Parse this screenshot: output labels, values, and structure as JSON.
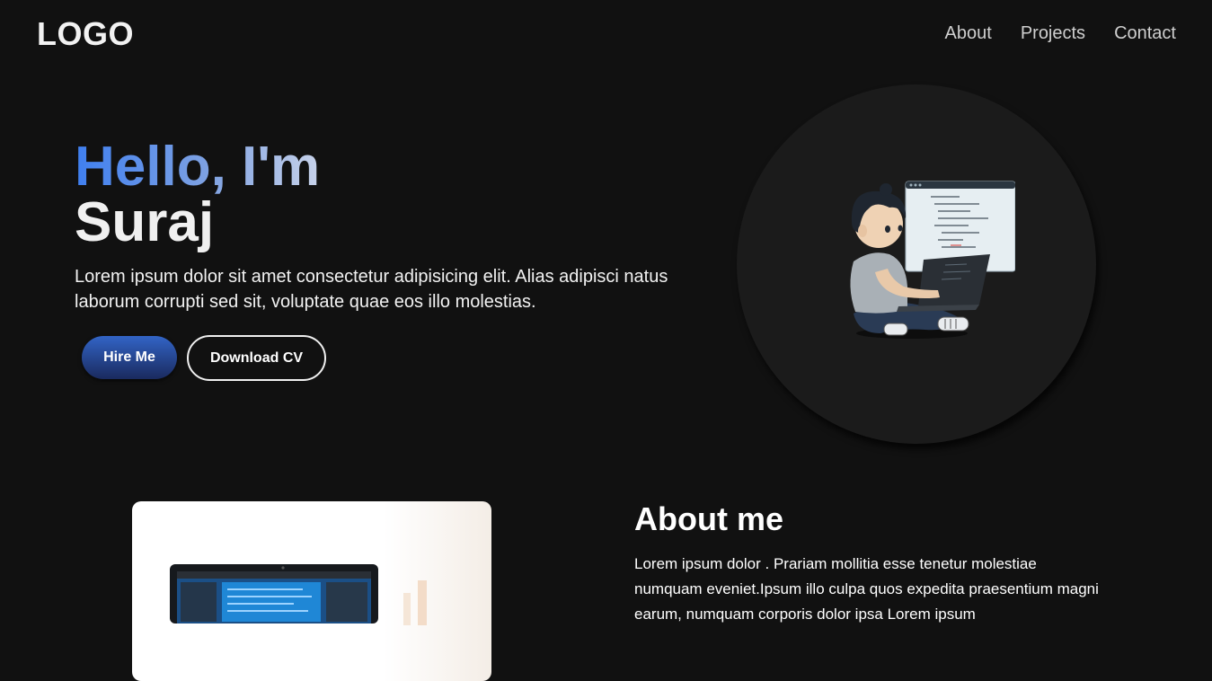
{
  "navbar": {
    "logo": "LOGO",
    "links": [
      "About",
      "Projects",
      "Contact"
    ]
  },
  "hero": {
    "greeting": "Hello, I'm",
    "name": "Suraj",
    "description": "Lorem ipsum dolor sit amet consectetur adipisicing elit. Alias adipisci natus laborum corrupti sed sit, voluptate quae eos illo molestias.",
    "hire_button": "Hire Me",
    "cv_button": "Download CV",
    "illustration": "boy-coding-on-laptop-icon"
  },
  "about": {
    "title": "About me",
    "text": "Lorem ipsum dolor . Prariam mollitia esse tenetur molestiae numquam eveniet.Ipsum illo culpa quos expedita praesentium magni earum, numquam corporis dolor ipsa Lorem ipsum",
    "image": "laptop-on-desk-icon"
  },
  "colors": {
    "background": "#111111",
    "accent_blue": "#3f7ff0",
    "circle": "#1b1b1b"
  }
}
